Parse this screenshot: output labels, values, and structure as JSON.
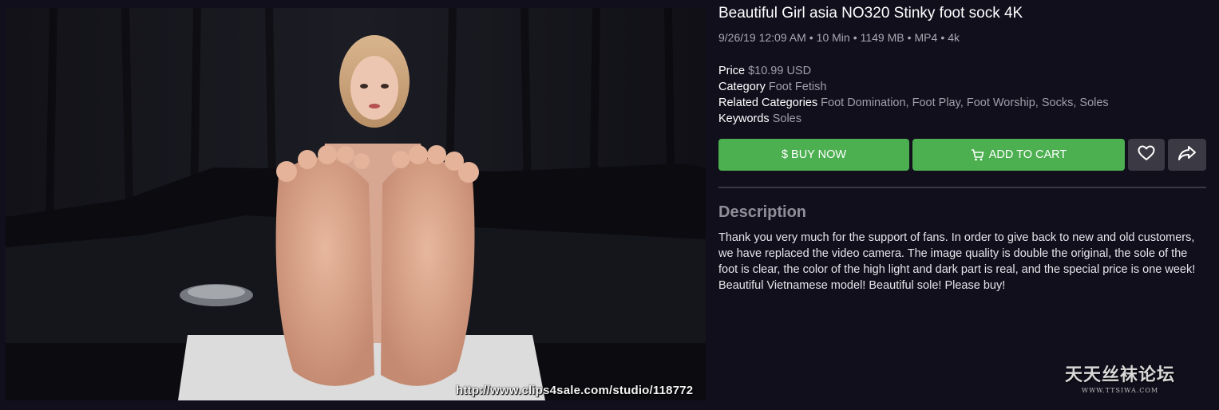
{
  "video": {
    "watermark": "http://www.clips4sale.com/studio/118772"
  },
  "product": {
    "title": "Beautiful Girl asia NO320 Stinky foot sock 4K",
    "meta": {
      "date": "9/26/19 12:09 AM",
      "duration": "10 Min",
      "size": "1149 MB",
      "format": "MP4",
      "quality": "4k",
      "separator": "•"
    },
    "price_label": "Price",
    "price_value": "$10.99 USD",
    "category_label": "Category",
    "category_value": "Foot Fetish",
    "related_label": "Related Categories",
    "related_value": "Foot Domination, Foot Play, Foot Worship, Socks, Soles",
    "keywords_label": "Keywords",
    "keywords_value": "Soles"
  },
  "actions": {
    "buy_now": "$ BUY NOW",
    "add_to_cart": "ADD TO CART",
    "favorite_icon": "heart-icon",
    "share_icon": "share-icon",
    "cart_icon": "cart-icon",
    "button_color": "#4caf50",
    "icon_button_color": "#3b3a44"
  },
  "description": {
    "heading": "Description",
    "text": "Thank you very much for the support of fans. In order to give back to new and old customers, we have replaced the video camera. The image quality is double the original, the sole of the foot is clear, the color of the high light and dark part is real, and the special price is one week! Beautiful Vietnamese model! Beautiful sole! Please buy!"
  },
  "forum_watermark": {
    "name": "天天丝袜论坛",
    "url": "WWW.TTSIWA.COM"
  },
  "colors": {
    "background": "#110f1c",
    "muted_text": "#a9a8b2",
    "divider": "#3a3946"
  }
}
